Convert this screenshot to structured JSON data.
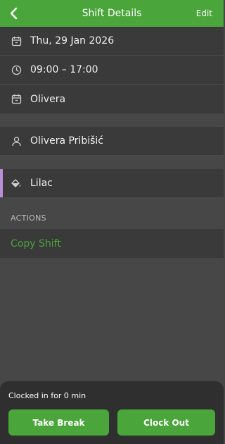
{
  "header": {
    "title": "Shift Details",
    "edit_label": "Edit"
  },
  "details": {
    "date": "Thu, 29 Jan 2026",
    "time": "09:00 – 17:00",
    "schedule": "Olivera"
  },
  "employee": {
    "name": "Olivera Pribišić"
  },
  "color": {
    "name": "Lilac",
    "swatch": "#b98ed6"
  },
  "actions": {
    "section_label": "ACTIONS",
    "copy_shift_label": "Copy Shift"
  },
  "clock": {
    "status": "Clocked in for 0 min",
    "take_break_label": "Take Break",
    "clock_out_label": "Clock Out"
  },
  "colors": {
    "accent": "#4aa53a",
    "background": "#474747",
    "row": "#3a3a3a",
    "panel": "#2f2f2f"
  }
}
